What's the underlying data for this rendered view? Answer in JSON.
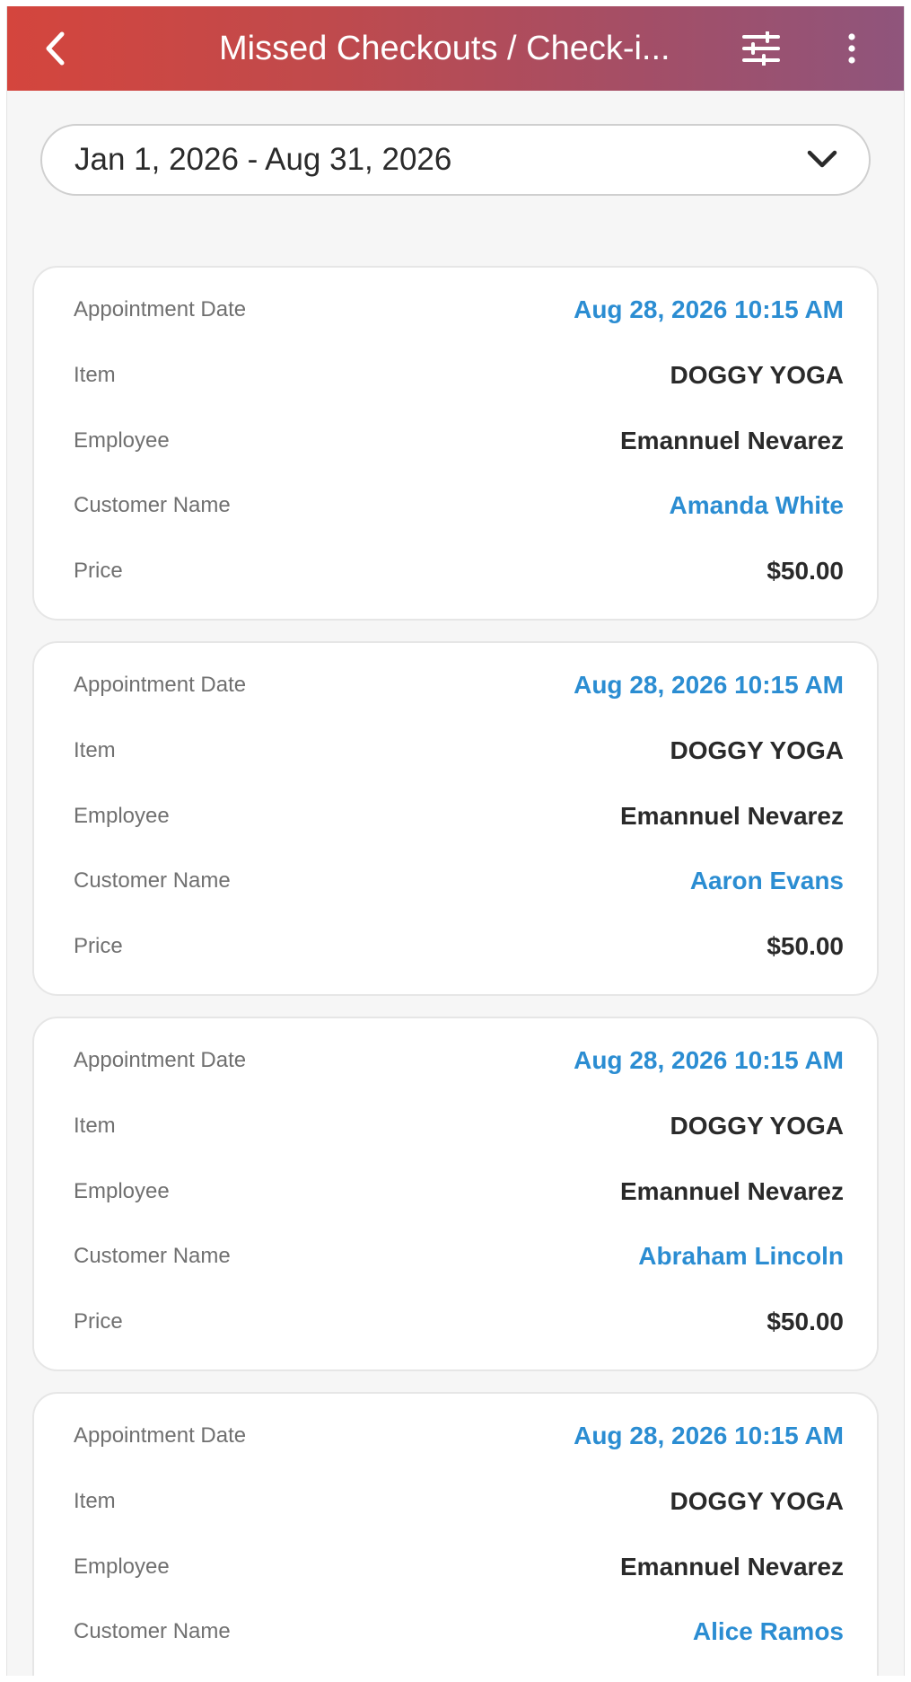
{
  "header": {
    "title": "Missed Checkouts / Check-i...",
    "back_icon": "chevron-left-icon",
    "filter_icon": "sliders-icon",
    "menu_icon": "more-vertical-icon"
  },
  "date_range": {
    "value": "Jan 1, 2026 - Aug 31, 2026",
    "icon": "chevron-down-icon"
  },
  "labels": {
    "appointment_date": "Appointment Date",
    "item": "Item",
    "employee": "Employee",
    "customer_name": "Customer Name",
    "price": "Price"
  },
  "records": [
    {
      "appointment_date": "Aug 28, 2026 10:15 AM",
      "item": "DOGGY YOGA",
      "employee": "Emannuel Nevarez",
      "customer_name": "Amanda White",
      "price": "$50.00"
    },
    {
      "appointment_date": "Aug 28, 2026 10:15 AM",
      "item": "DOGGY YOGA",
      "employee": "Emannuel Nevarez",
      "customer_name": "Aaron Evans",
      "price": "$50.00"
    },
    {
      "appointment_date": "Aug 28, 2026 10:15 AM",
      "item": "DOGGY YOGA",
      "employee": "Emannuel Nevarez",
      "customer_name": "Abraham Lincoln",
      "price": "$50.00"
    },
    {
      "appointment_date": "Aug 28, 2026 10:15 AM",
      "item": "DOGGY YOGA",
      "employee": "Emannuel Nevarez",
      "customer_name": "Alice Ramos",
      "price": ""
    }
  ],
  "colors": {
    "header_gradient_start": "#d4453d",
    "header_gradient_end": "#8f557c",
    "link": "#2b8dd2"
  }
}
